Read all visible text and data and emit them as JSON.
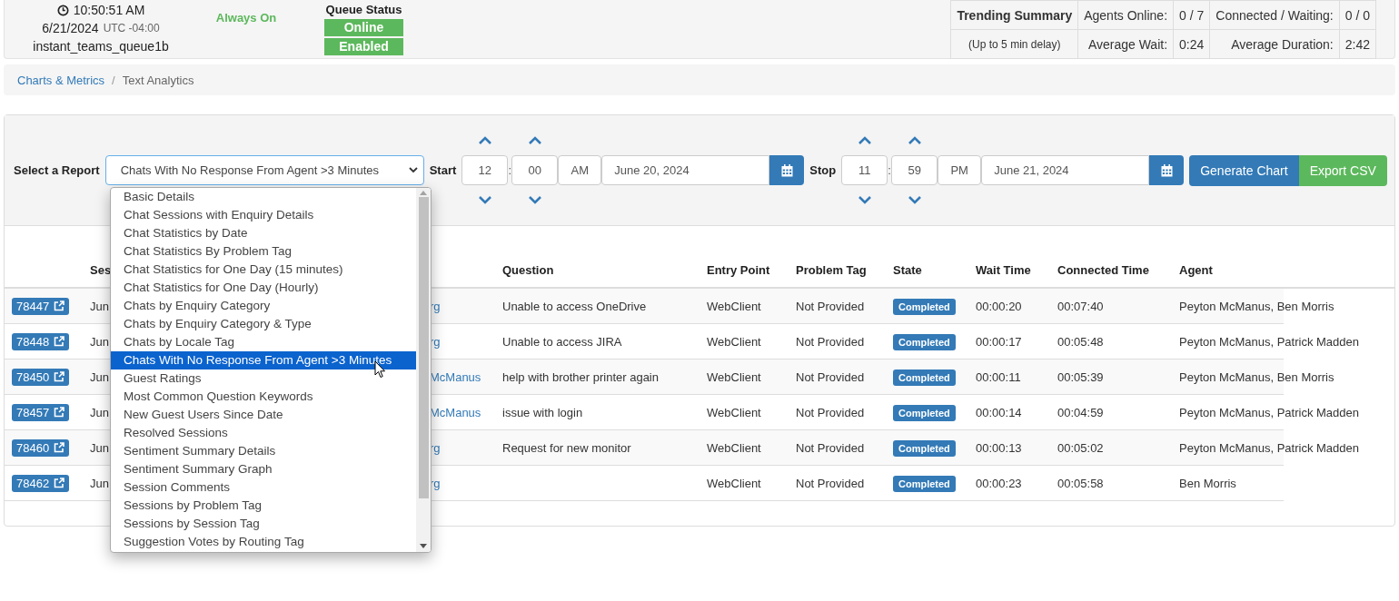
{
  "header": {
    "time": "10:50:51 AM",
    "date": "6/21/2024",
    "utc_offset": "UTC -04:00",
    "queue_name": "instant_teams_queue1b",
    "mode": "Always On",
    "queue_status": {
      "title": "Queue Status",
      "badges": [
        "Online",
        "Enabled"
      ]
    },
    "trending": {
      "title": "Trending Summary",
      "subtitle": "(Up to 5 min delay)",
      "rows": [
        [
          {
            "label": "Agents Online:",
            "value": "0 / 7"
          },
          {
            "label": "Connected / Waiting:",
            "value": "0 / 0"
          }
        ],
        [
          {
            "label": "Average Wait:",
            "value": "0:24"
          },
          {
            "label": "Average Duration:",
            "value": "2:42"
          }
        ]
      ]
    }
  },
  "breadcrumb": {
    "separator": "/",
    "items": [
      {
        "label": "Charts & Metrics",
        "current": false
      },
      {
        "label": "Text Analytics",
        "current": true
      }
    ]
  },
  "report_form": {
    "label": "Select a Report",
    "select_value": "Chats With No Response From Agent >3 Minutes",
    "ranges": [
      {
        "label": "Start",
        "hour": "12",
        "time_separator": ":",
        "minute": "00",
        "ampm": "AM",
        "date": "June 20, 2024"
      },
      {
        "label": "Stop",
        "hour": "11",
        "time_separator": ":",
        "minute": "59",
        "ampm": "PM",
        "date": "June 21, 2024"
      }
    ],
    "buttons": [
      {
        "label": "Generate Chart",
        "kind": "primary"
      },
      {
        "label": "Export CSV",
        "kind": "success"
      }
    ]
  },
  "dropdown": {
    "items": [
      {
        "label": "Basic Details",
        "selected": false
      },
      {
        "label": "Chat Sessions with Enquiry Details",
        "selected": false
      },
      {
        "label": "Chat Statistics by Date",
        "selected": false
      },
      {
        "label": "Chat Statistics By Problem Tag",
        "selected": false
      },
      {
        "label": "Chat Statistics for One Day (15 minutes)",
        "selected": false
      },
      {
        "label": "Chat Statistics for One Day (Hourly)",
        "selected": false
      },
      {
        "label": "Chats by Enquiry Category",
        "selected": false
      },
      {
        "label": "Chats by Enquiry Category & Type",
        "selected": false
      },
      {
        "label": "Chats by Locale Tag",
        "selected": false
      },
      {
        "label": "Chats With No Response From Agent >3 Minutes",
        "selected": true
      },
      {
        "label": "Guest Ratings",
        "selected": false
      },
      {
        "label": "Most Common Question Keywords",
        "selected": false
      },
      {
        "label": "New Guest Users Since Date",
        "selected": false
      },
      {
        "label": "Resolved Sessions",
        "selected": false
      },
      {
        "label": "Sentiment Summary Details",
        "selected": false
      },
      {
        "label": "Sentiment Summary Graph",
        "selected": false
      },
      {
        "label": "Session Comments",
        "selected": false
      },
      {
        "label": "Sessions by Problem Tag",
        "selected": false
      },
      {
        "label": "Sessions by Session Tag",
        "selected": false
      },
      {
        "label": "Suggestion Votes by Routing Tag",
        "selected": false
      }
    ]
  },
  "table": {
    "columns": [
      "Ses",
      "Question",
      "Entry Point",
      "Problem Tag",
      "State",
      "Wait Time",
      "Connected Time",
      "Agent"
    ],
    "rows": [
      {
        "id": "78447",
        "column_2": "Jun",
        "column_3": "rg",
        "question": "Unable to access OneDrive",
        "entry_point": "WebClient",
        "problem_tag": "Not Provided",
        "state": "Completed",
        "wait_time": "00:00:20",
        "connected_time": "00:07:40",
        "agent": "Peyton McManus, Ben Morris"
      },
      {
        "id": "78448",
        "column_2": "Jun",
        "column_3": "rg",
        "question": "Unable to access JIRA",
        "entry_point": "WebClient",
        "problem_tag": "Not Provided",
        "state": "Completed",
        "wait_time": "00:00:17",
        "connected_time": "00:05:48",
        "agent": "Peyton McManus, Patrick Madden"
      },
      {
        "id": "78450",
        "column_2": "Jun",
        "column_3": "McManus",
        "question": "help with brother printer again",
        "entry_point": "WebClient",
        "problem_tag": "Not Provided",
        "state": "Completed",
        "wait_time": "00:00:11",
        "connected_time": "00:05:39",
        "agent": "Peyton McManus, Ben Morris"
      },
      {
        "id": "78457",
        "column_2": "Jun",
        "column_3": "McManus",
        "question": "issue with login",
        "entry_point": "WebClient",
        "problem_tag": "Not Provided",
        "state": "Completed",
        "wait_time": "00:00:14",
        "connected_time": "00:04:59",
        "agent": "Peyton McManus, Patrick Madden"
      },
      {
        "id": "78460",
        "column_2": "Jun",
        "column_3": "rg",
        "question": "Request for new monitor",
        "entry_point": "WebClient",
        "problem_tag": "Not Provided",
        "state": "Completed",
        "wait_time": "00:00:13",
        "connected_time": "00:05:02",
        "agent": "Peyton McManus, Patrick Madden"
      },
      {
        "id": "78462",
        "column_2": "Jun",
        "column_3": "rg",
        "entry_point": "WebClient",
        "problem_tag": "Not Provided",
        "state": "Completed",
        "wait_time": "00:00:23",
        "connected_time": "00:05:58",
        "agent": "Ben Morris"
      }
    ]
  }
}
